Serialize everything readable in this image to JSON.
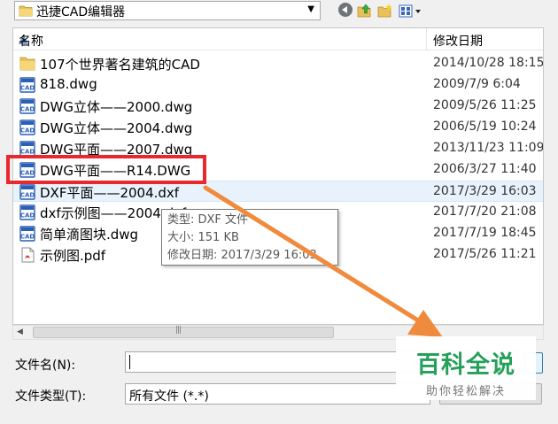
{
  "toolbar": {
    "location": "迅捷CAD编辑器"
  },
  "columns": {
    "name": "名称",
    "date": "修改日期"
  },
  "files": [
    {
      "name": "107个世界著名建筑的CAD",
      "date": "2014/10/28 18:15",
      "icon": "folder-icon"
    },
    {
      "name": "818.dwg",
      "date": "2009/7/9 6:04",
      "icon": "cad-file-icon"
    },
    {
      "name": "DWG立体——2000.dwg",
      "date": "2009/5/26 11:25",
      "icon": "cad-file-icon"
    },
    {
      "name": "DWG立体——2004.dwg",
      "date": "2006/5/19 10:24",
      "icon": "cad-file-icon"
    },
    {
      "name": "DWG平面——2007.dwg",
      "date": "2013/11/23 11:09",
      "icon": "cad-file-icon"
    },
    {
      "name": "DWG平面——R14.DWG",
      "date": "2006/3/27 11:40",
      "icon": "cad-file-icon"
    },
    {
      "name": "DXF平面——2004.dxf",
      "date": "2017/3/29 16:03",
      "icon": "cad-file-icon"
    },
    {
      "name": "dxf示例图——2004.dxf",
      "date": "2017/7/20 21:08",
      "icon": "cad-file-icon"
    },
    {
      "name": "简单滴图块.dwg",
      "date": "2017/7/19 18:45",
      "icon": "cad-file-icon"
    },
    {
      "name": "示例图.pdf",
      "date": "2017/5/26 11:21",
      "icon": "pdf-file-icon"
    }
  ],
  "tooltip": {
    "type": "类型: DXF 文件",
    "size": "大小: 151 KB",
    "modified": "修改日期: 2017/3/29 16:03"
  },
  "form": {
    "filename_label": "文件名(N):",
    "filename_value": "",
    "filetype_label": "文件类型(T):",
    "filetype_value": "所有文件 (*.*)"
  },
  "watermark": {
    "main": "百科全说",
    "sub": "助你轻松解决"
  },
  "colors": {
    "highlight_box": "#e8282d",
    "arrow": "#f08a3c",
    "watermark_green": "#25a05a"
  }
}
